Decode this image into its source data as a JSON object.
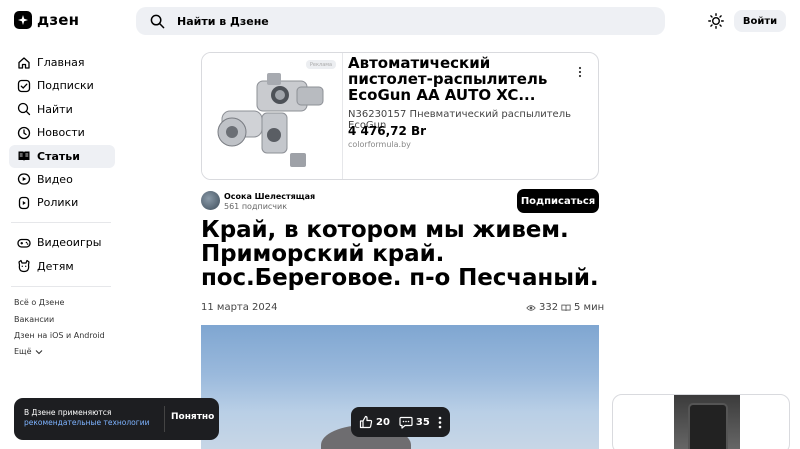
{
  "header": {
    "logo_text": "дзен",
    "search_placeholder": "Найти в Дзене",
    "login_label": "Войти"
  },
  "sidebar": {
    "items": [
      {
        "label": "Главная",
        "icon": "home-icon"
      },
      {
        "label": "Подписки",
        "icon": "subscriptions-icon"
      },
      {
        "label": "Найти",
        "icon": "search-icon"
      },
      {
        "label": "Новости",
        "icon": "news-icon"
      },
      {
        "label": "Статьи",
        "icon": "articles-icon"
      },
      {
        "label": "Видео",
        "icon": "video-icon"
      },
      {
        "label": "Ролики",
        "icon": "shorts-icon"
      },
      {
        "label": "Видеоигры",
        "icon": "gamepad-icon"
      },
      {
        "label": "Детям",
        "icon": "kids-icon"
      }
    ],
    "active_index": 4,
    "footer_links": [
      "Всё о Дзене",
      "Вакансии",
      "Дзен на iOS и Android",
      "Ещё"
    ]
  },
  "ad": {
    "badge": "Реклама",
    "title": "Автоматический пистолет-распылитель EcoGun AA AUTO XC...",
    "description": "N36230157 Пневматический распылитель EcoGun",
    "price": "4 476,72 Br",
    "domain": "colorformula.by"
  },
  "article": {
    "author_name": "Осока Шелестящая",
    "author_subscribers": "561 подписчик",
    "subscribe_label": "Подписаться",
    "title": "Край, в котором мы живем. Приморский край. пос.Береговое. п-о Песчаный.",
    "date": "11 марта 2024",
    "views": "332",
    "read_time": "5 мин"
  },
  "reactions": {
    "likes": "20",
    "comments": "35"
  },
  "cookie": {
    "text": "В Дзене применяются",
    "link": "рекомендательные технологии",
    "button": "Понятно"
  },
  "colors": {
    "accent_bg": "#eef0f4",
    "dark": "#1d1e21",
    "link": "#7db3ff"
  }
}
